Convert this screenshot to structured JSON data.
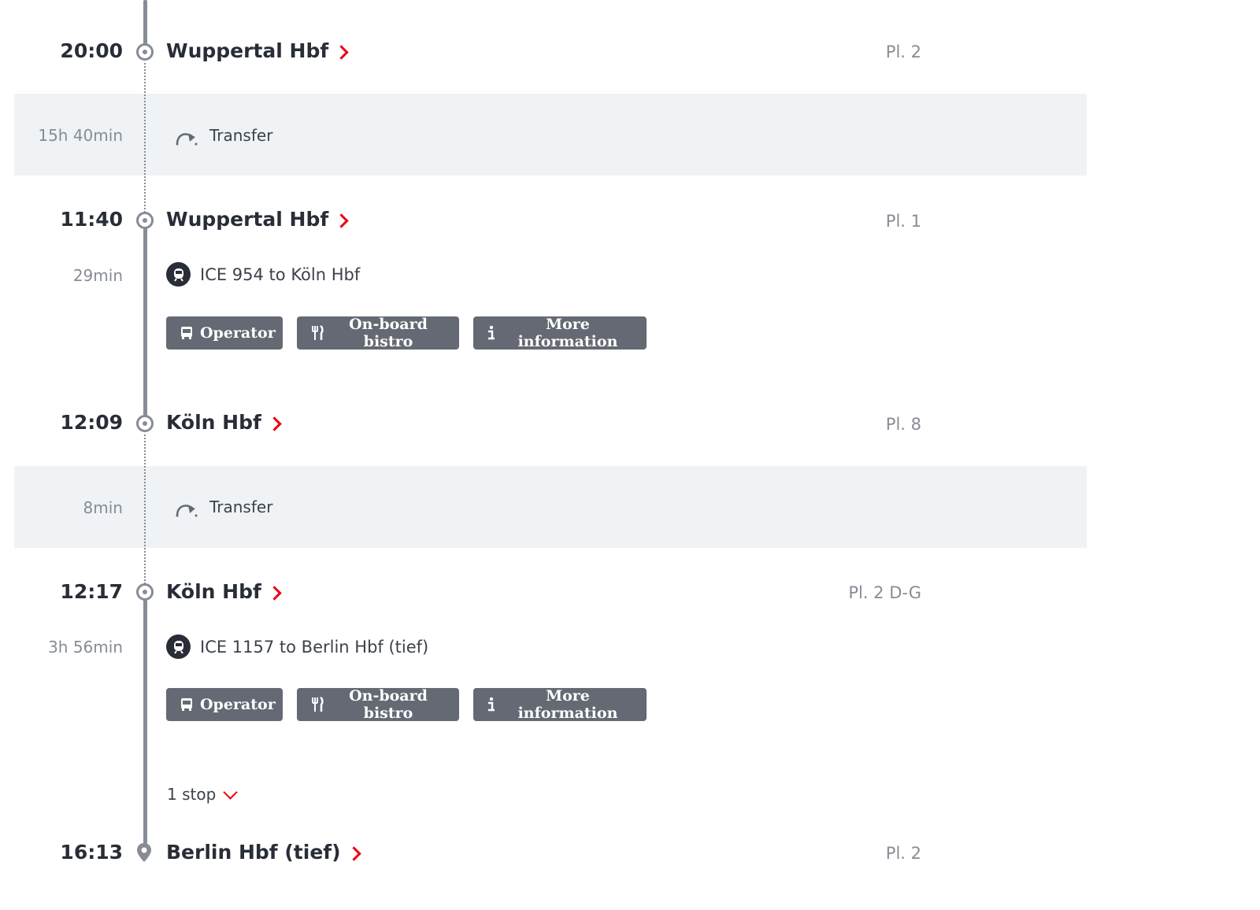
{
  "legs": [
    {
      "time": "20:00",
      "station": "Wuppertal Hbf",
      "platform": "Pl. 2"
    },
    {
      "time": "11:40",
      "station": "Wuppertal Hbf",
      "platform": "Pl. 1"
    },
    {
      "time": "12:09",
      "station": "Köln Hbf",
      "platform": "Pl. 8"
    },
    {
      "time": "12:17",
      "station": "Köln Hbf",
      "platform": "Pl. 2 D-G"
    },
    {
      "time": "16:13",
      "station": "Berlin Hbf (tief)",
      "platform": "Pl. 2"
    }
  ],
  "transfers": [
    {
      "duration": "15h 40min",
      "label": "Transfer"
    },
    {
      "duration": "8min",
      "label": "Transfer"
    }
  ],
  "trains": [
    {
      "duration": "29min",
      "label": "ICE 954 to Köln Hbf"
    },
    {
      "duration": "3h 56min",
      "label": "ICE 1157 to Berlin Hbf (tief)"
    }
  ],
  "buttons": {
    "operator": "Operator",
    "bistro": "On-board bistro",
    "more_info": "More information"
  },
  "stops_toggle": "1 stop",
  "colors": {
    "accent": "#ec0016",
    "line": "#878c96",
    "button_bg": "#646973",
    "band": "#f0f3f5"
  }
}
